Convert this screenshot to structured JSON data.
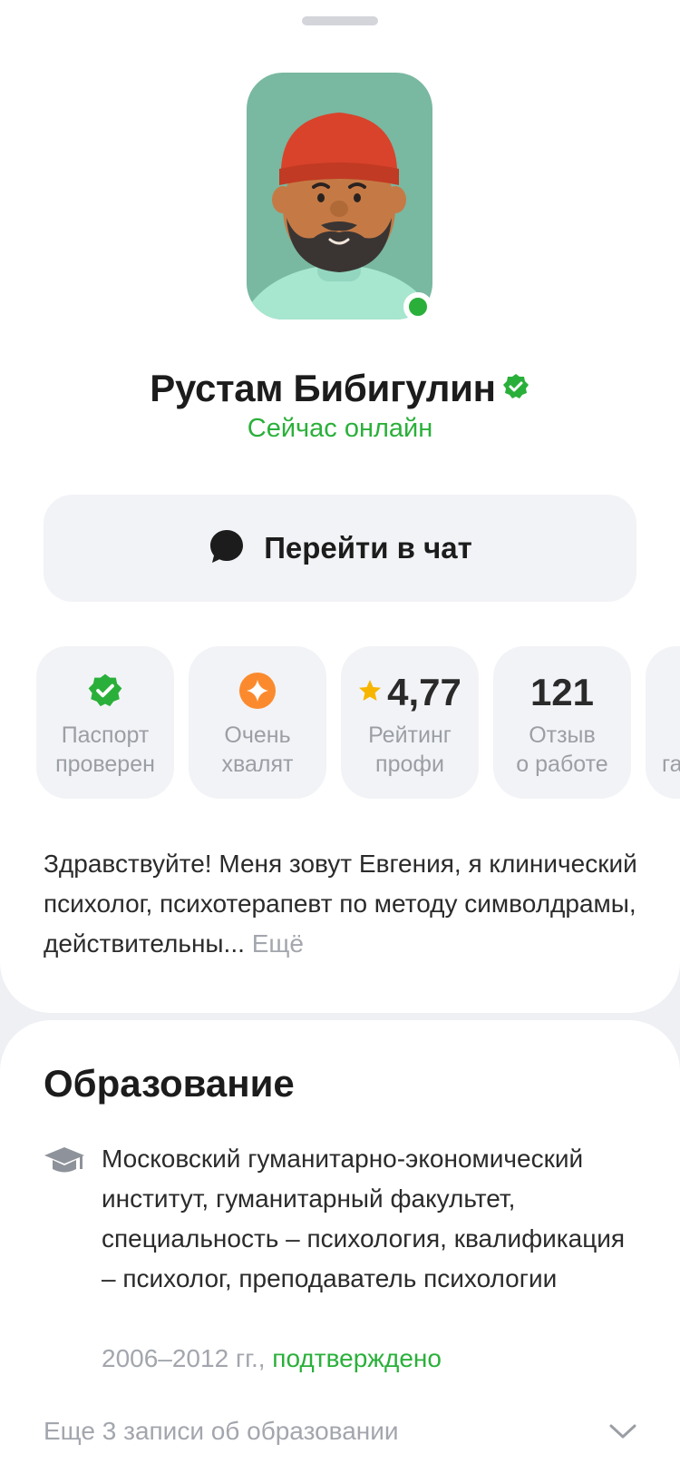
{
  "profile": {
    "name": "Рустам Бибигулин",
    "status": "Сейчас онлайн"
  },
  "chat_button": {
    "label": "Перейти в чат"
  },
  "badges": [
    {
      "top": "",
      "label1": "Паспорт",
      "label2": "проверен",
      "icon": "verified-check-icon"
    },
    {
      "top": "",
      "label1": "Очень",
      "label2": "хвалят",
      "icon": "sparkle-icon"
    },
    {
      "top": "4,77",
      "label1": "Рейтинг",
      "label2": "профи",
      "icon": "star-icon"
    },
    {
      "top": "121",
      "label1": "Отзыв",
      "label2": "о работе",
      "icon": ""
    },
    {
      "top": "",
      "label1": "",
      "label2": "га",
      "icon": ""
    }
  ],
  "about": {
    "text": "Здравствуйте! Меня зовут Евгения, я клинический психолог, психотерапевт по методу символдрамы, действительны...",
    "more": "Ещё"
  },
  "education": {
    "title": "Образование",
    "entry": "Московский гуманитарно-экономический институт, гуманитарный факультет, специальность – психология, квалификация – психолог, преподаватель психологии",
    "years": "2006–2012 гг.,",
    "verified": "подтверждено",
    "more_label": "Еще 3 записи об образовании"
  },
  "colors": {
    "accent_green": "#2ab03a",
    "avatar_bg": "#79b8a1",
    "chip_bg": "#f2f3f6",
    "orange": "#fb8a2e",
    "star": "#f7b500"
  }
}
